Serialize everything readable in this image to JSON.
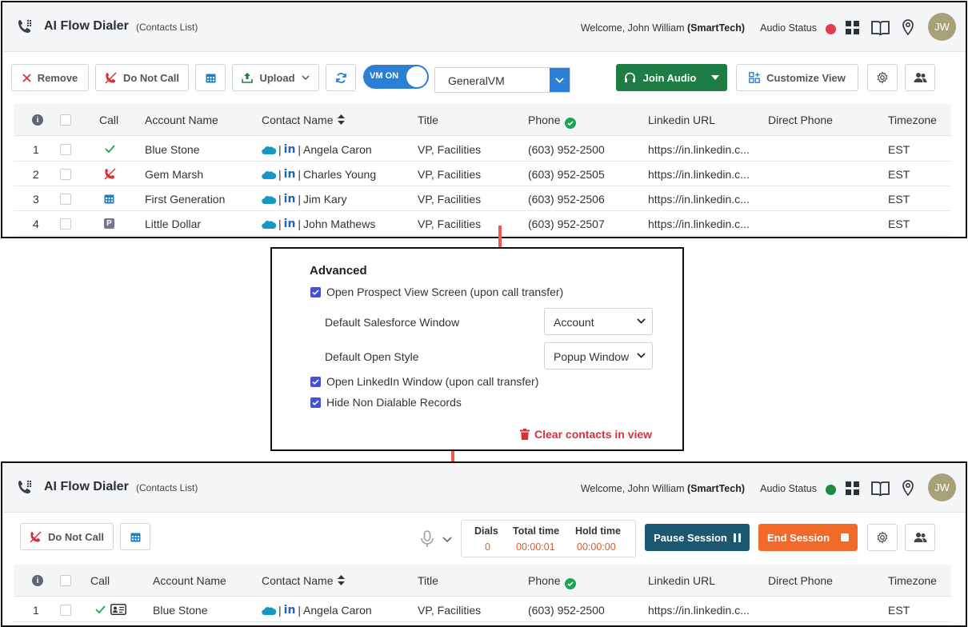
{
  "app": {
    "title": "AI Flow Dialer",
    "subtitle": "(Contacts List)",
    "welcome_prefix": "Welcome, John William ",
    "org": "(SmartTech)",
    "audio_status_label": "Audio Status",
    "avatar_initials": "JW"
  },
  "colors": {
    "status_off": "#e03e4d",
    "status_on": "#1c8a45",
    "green_button": "#1e7d45",
    "navy_button": "#1c5872",
    "orange_button": "#f26a2a",
    "accent_blue": "#2b7fd4",
    "danger": "#d9313a",
    "checkbox": "#4450d6"
  },
  "icons": [
    "phone-dialer-icon",
    "grid-icon",
    "book-icon",
    "location-pin-icon",
    "remove-x-icon",
    "do-not-call-icon",
    "calendar-icon",
    "upload-icon",
    "refresh-icon",
    "headset-icon",
    "customize-view-icon",
    "gear-icon",
    "users-icon",
    "info-icon",
    "sort-icon",
    "check-circle-icon",
    "salesforce-icon",
    "linkedin-icon",
    "trash-icon",
    "microphone-icon",
    "pause-icon",
    "stop-icon"
  ],
  "toolbar": {
    "remove": "Remove",
    "do_not_call": "Do Not Call",
    "upload": "Upload",
    "vm_toggle": "VM ON",
    "vm_select": "GeneralVM",
    "join_audio": "Join Audio",
    "customize_view": "Customize View"
  },
  "table": {
    "headers": {
      "call": "Call",
      "account": "Account Name",
      "contact": "Contact Name",
      "title": "Title",
      "phone": "Phone",
      "linkedin": "Linkedin URL",
      "direct_phone": "Direct Phone",
      "timezone": "Timezone"
    },
    "rows": [
      {
        "num": "1",
        "account": "Blue Stone",
        "contact": "Angela Caron",
        "title": "VP, Facilities",
        "phone": "(603) 952-2500",
        "linkedin": "https://in.linkedin.c...",
        "timezone": "EST",
        "call_icon": "check-icon"
      },
      {
        "num": "2",
        "account": "Gem Marsh",
        "contact": "Charles Young",
        "title": "VP, Facilities",
        "phone": "(603) 952-2505",
        "linkedin": "https://in.linkedin.c...",
        "timezone": "EST",
        "call_icon": "do-not-call-icon"
      },
      {
        "num": "3",
        "account": "First Generation",
        "contact": "Jim Kary",
        "title": "VP, Facilities",
        "phone": "(603) 952-2506",
        "linkedin": "https://in.linkedin.c...",
        "timezone": "EST",
        "call_icon": "calendar-icon"
      },
      {
        "num": "4",
        "account": "Little Dollar",
        "contact": "John Mathews",
        "title": "VP, Facilities",
        "phone": "(603) 952-2507",
        "linkedin": "https://in.linkedin.c...",
        "timezone": "EST",
        "call_icon": "parked-icon"
      }
    ],
    "parked_letter": "P"
  },
  "advanced": {
    "title": "Advanced",
    "open_prospect": "Open Prospect View Screen (upon call transfer)",
    "default_sf_window_label": "Default Salesforce Window",
    "default_sf_window_value": "Account",
    "default_open_style_label": "Default Open Style",
    "default_open_style_value": "Popup Window",
    "open_linkedin": "Open LinkedIn Window (upon call transfer)",
    "hide_non_dialable": "Hide Non Dialable Records",
    "clear_contacts": "Clear contacts in view"
  },
  "session": {
    "do_not_call": "Do Not Call",
    "dials_label": "Dials",
    "dials_value": "0",
    "total_time_label": "Total time",
    "total_time_value": "00:00:01",
    "hold_time_label": "Hold time",
    "hold_time_value": "00:00:00",
    "pause": "Pause Session",
    "end": "End Session",
    "row": {
      "num": "1",
      "account": "Blue Stone",
      "contact": "Angela Caron",
      "title": "VP, Facilities",
      "phone": "(603) 952-2500",
      "linkedin": "https://in.linkedin.c...",
      "timezone": "EST"
    }
  }
}
